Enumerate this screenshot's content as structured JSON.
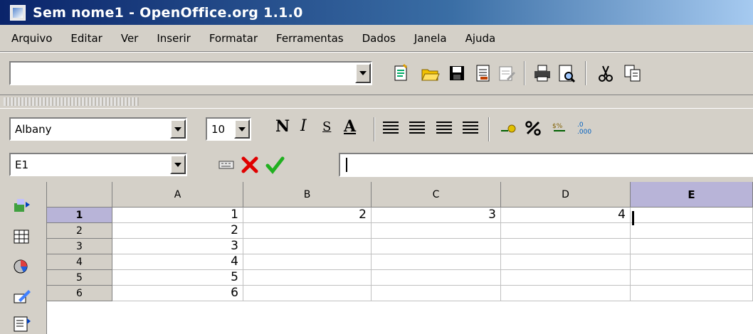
{
  "window": {
    "title": "Sem nome1 - OpenOffice.org 1.1.0"
  },
  "menu": [
    "Arquivo",
    "Editar",
    "Ver",
    "Inserir",
    "Formatar",
    "Ferramentas",
    "Dados",
    "Janela",
    "Ajuda"
  ],
  "function_bar": {
    "url_value": "",
    "icons": [
      "new-document-icon",
      "open-folder-icon",
      "save-disk-icon",
      "edit-file-icon",
      "edit-mode-icon",
      "print-icon",
      "page-preview-icon",
      "cut-icon",
      "copy-icon"
    ]
  },
  "object_bar": {
    "font_name": "Albany",
    "font_size": "10",
    "bold_label": "N",
    "italic_label": "I",
    "underline_label": "S",
    "font_color_label": "A"
  },
  "formula_bar": {
    "name_box": "E1",
    "input_value": ""
  },
  "left_toolbar_icons": [
    "insert-icon",
    "insert-cell-icon",
    "chart-icon",
    "draw-icon",
    "form-icon"
  ],
  "grid": {
    "columns": [
      "A",
      "B",
      "C",
      "D",
      "E"
    ],
    "active_column": "E",
    "rows": [
      {
        "label": "1",
        "cells": [
          "1",
          "2",
          "3",
          "4",
          ""
        ]
      },
      {
        "label": "2",
        "cells": [
          "2",
          "",
          "",
          "",
          ""
        ]
      },
      {
        "label": "3",
        "cells": [
          "3",
          "",
          "",
          "",
          ""
        ]
      },
      {
        "label": "4",
        "cells": [
          "4",
          "",
          "",
          "",
          ""
        ]
      },
      {
        "label": "5",
        "cells": [
          "5",
          "",
          "",
          "",
          ""
        ]
      },
      {
        "label": "6",
        "cells": [
          "6",
          "",
          "",
          "",
          ""
        ]
      }
    ],
    "active_row": "1"
  },
  "colors": {
    "titlebar_start": "#0a246a",
    "titlebar_end": "#a6caf0",
    "chrome": "#d4d0c8",
    "active_header": "#b8b4d8"
  }
}
